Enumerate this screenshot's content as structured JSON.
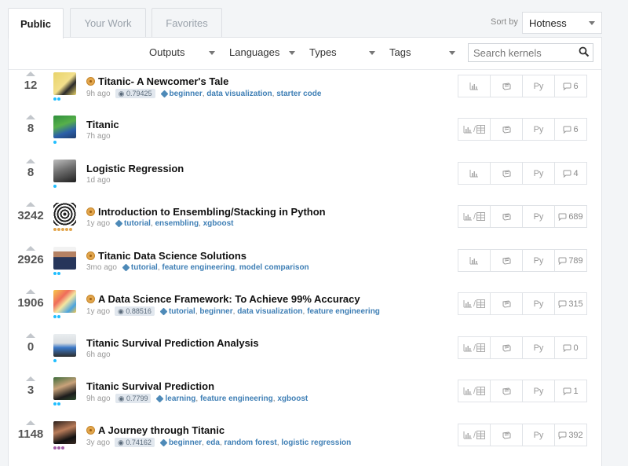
{
  "tabs": [
    {
      "label": "Public",
      "active": true
    },
    {
      "label": "Your Work",
      "active": false
    },
    {
      "label": "Favorites",
      "active": false
    }
  ],
  "sort": {
    "label": "Sort by",
    "value": "Hotness"
  },
  "filters": {
    "outputs": "Outputs",
    "languages": "Languages",
    "types": "Types",
    "tags": "Tags",
    "search_placeholder": "Search kernels"
  },
  "colors": {
    "accent": "#3f7fb5",
    "medal": "#e2a64d",
    "dot_blue": "#20beff",
    "dot_gold": "#e2a64d",
    "dot_purple": "#a360a8"
  },
  "kernels": [
    {
      "votes": "12",
      "title": "Titanic- A Newcomer's Tale",
      "medal": true,
      "time": "9h ago",
      "score": "0.79425",
      "tags": [
        "beginner",
        "data visualization",
        "starter code"
      ],
      "output": "chart",
      "comments": "6",
      "dots": [
        "blue",
        "blue"
      ],
      "avatar": "yellow"
    },
    {
      "votes": "8",
      "title": "Titanic",
      "medal": false,
      "time": "7h ago",
      "score": "",
      "tags": [],
      "output": "chart-table",
      "comments": "6",
      "dots": [
        "blue"
      ],
      "avatar": "green"
    },
    {
      "votes": "8",
      "title": "Logistic Regression",
      "medal": false,
      "time": "1d ago",
      "score": "",
      "tags": [],
      "output": "chart",
      "comments": "4",
      "dots": [
        "blue"
      ],
      "avatar": "gray"
    },
    {
      "votes": "3242",
      "title": "Introduction to Ensembling/Stacking in Python",
      "medal": true,
      "time": "1y ago",
      "score": "",
      "tags": [
        "tutorial",
        "ensembling",
        "xgboost"
      ],
      "output": "chart-table",
      "comments": "689",
      "dots": [
        "gold",
        "gold",
        "gold",
        "gold",
        "gold"
      ],
      "avatar": "pattern"
    },
    {
      "votes": "2926",
      "title": "Titanic Data Science Solutions",
      "medal": true,
      "time": "3mo ago",
      "score": "",
      "tags": [
        "tutorial",
        "feature engineering",
        "model comparison"
      ],
      "output": "chart",
      "comments": "789",
      "dots": [
        "blue",
        "blue"
      ],
      "avatar": "person"
    },
    {
      "votes": "1906",
      "title": "A Data Science Framework: To Achieve 99% Accuracy",
      "medal": true,
      "time": "1y ago",
      "score": "0.88516",
      "tags": [
        "tutorial",
        "beginner",
        "data visualization",
        "feature engineering"
      ],
      "output": "chart-table",
      "comments": "315",
      "dots": [
        "blue",
        "blue"
      ],
      "avatar": "colorful"
    },
    {
      "votes": "0",
      "title": "Titanic Survival Prediction Analysis",
      "medal": false,
      "time": "6h ago",
      "score": "",
      "tags": [],
      "output": "chart-table",
      "comments": "0",
      "dots": [
        "blue"
      ],
      "avatar": "white"
    },
    {
      "votes": "3",
      "title": "Titanic Survival Prediction",
      "medal": false,
      "time": "9h ago",
      "score": "0.7799",
      "tags": [
        "learning",
        "feature engineering",
        "xgboost"
      ],
      "output": "chart-table",
      "comments": "1",
      "dots": [
        "blue",
        "blue"
      ],
      "avatar": "dark-green"
    },
    {
      "votes": "1148",
      "title": "A Journey through Titanic",
      "medal": true,
      "time": "3y ago",
      "score": "0.74162",
      "tags": [
        "beginner",
        "eda",
        "random forest",
        "logistic regression"
      ],
      "output": "chart-table",
      "comments": "392",
      "dots": [
        "purple",
        "purple",
        "purple"
      ],
      "avatar": "dark"
    }
  ],
  "lang_label": "Py"
}
